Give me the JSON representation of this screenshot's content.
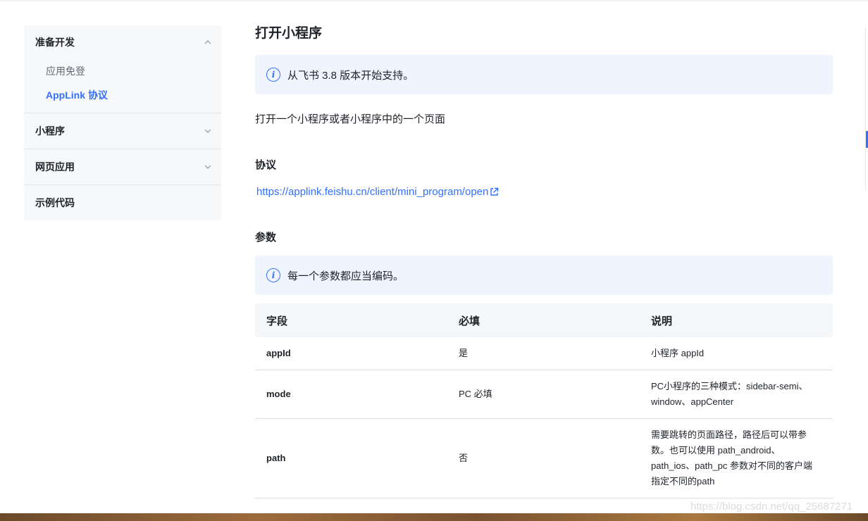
{
  "sidebar": {
    "groups": [
      {
        "label": "准备开发",
        "items": [
          {
            "label": "应用免登"
          },
          {
            "label": "AppLink 协议"
          }
        ]
      },
      {
        "label": "小程序"
      },
      {
        "label": "网页应用"
      },
      {
        "label": "示例代码"
      }
    ]
  },
  "content": {
    "title": "打开小程序",
    "version_note": "从飞书 3.8 版本开始支持。",
    "description": "打开一个小程序或者小程序中的一个页面",
    "protocol_heading": "协议",
    "protocol_link": "https://applink.feishu.cn/client/mini_program/open",
    "params_heading": "参数",
    "params_note": "每一个参数都应当编码。",
    "table": {
      "headers": [
        "字段",
        "必填",
        "说明"
      ],
      "rows": [
        {
          "field": "appId",
          "required": "是",
          "desc": "小程序 appId"
        },
        {
          "field": "mode",
          "required": "PC 必填",
          "desc": "PC小程序的三种模式：sidebar-semi、window、appCenter"
        },
        {
          "field": "path",
          "required": "否",
          "desc": "需要跳转的页面路径，路径后可以带参数。也可以使用 path_android、path_ios、path_pc 参数对不同的客户端指定不同的path"
        }
      ]
    }
  },
  "watermark": "https://blog.csdn.net/qq_25687271",
  "colors": {
    "accent": "#3370ff",
    "note_bg": "#f0f4ff",
    "sidebar_bg": "#f7f8fa"
  }
}
